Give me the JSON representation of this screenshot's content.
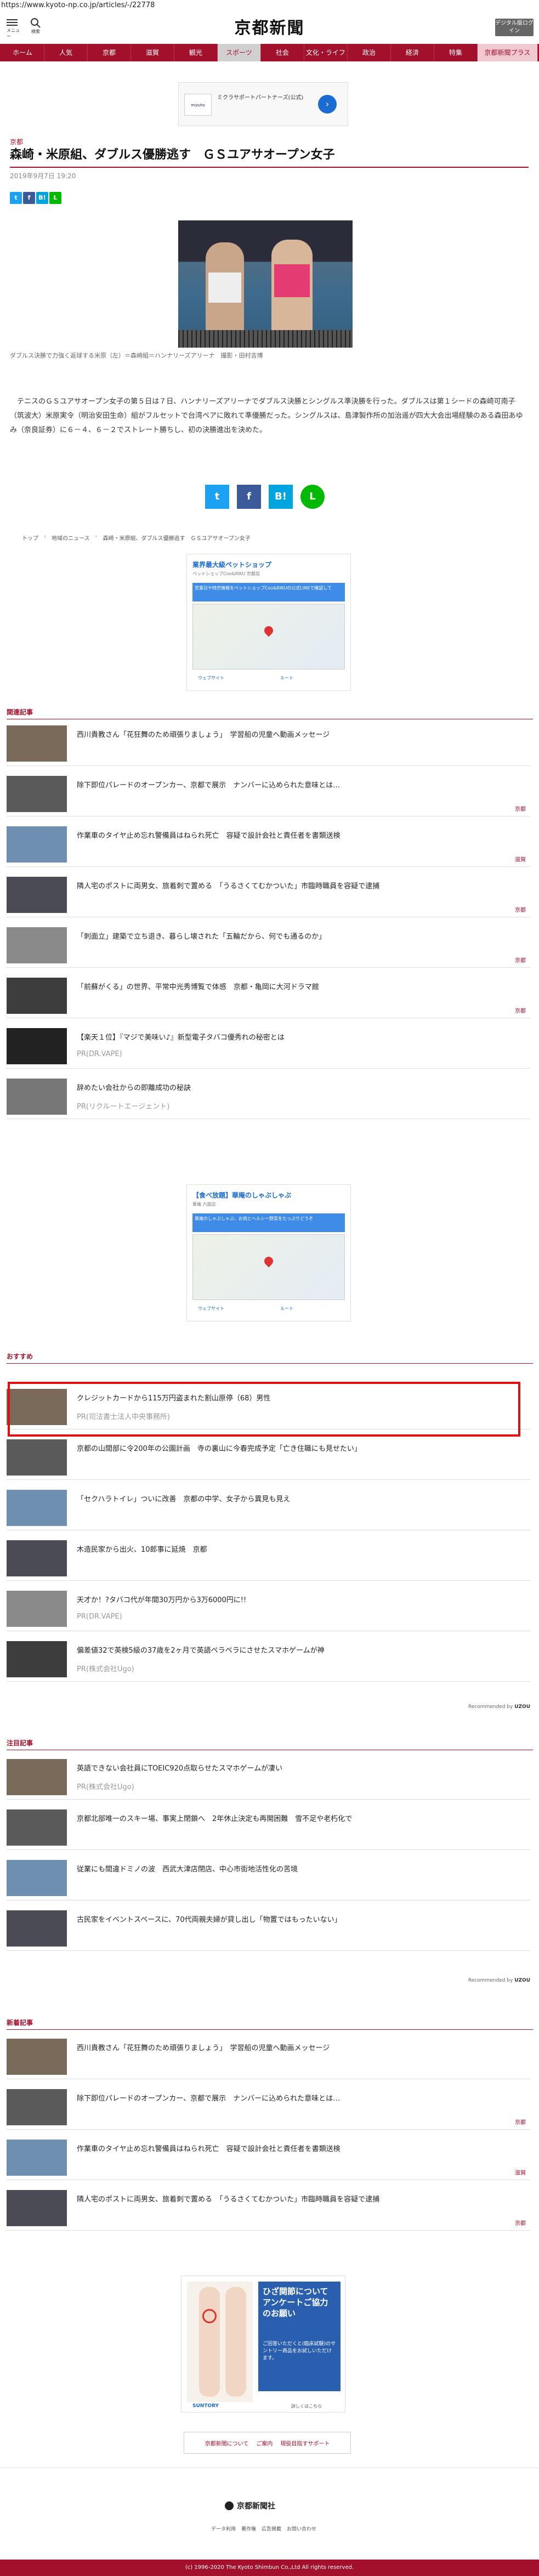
{
  "browser": {
    "url": "https://www.kyoto-np.co.jp/articles/-/22778"
  },
  "header": {
    "menu_label": "メニュー",
    "search_label": "検索",
    "logo": "京都新聞",
    "digital_btn": "デジタル版ログイン"
  },
  "gnav": [
    "ホーム",
    "人気",
    "京都",
    "滋賀",
    "観光",
    "スポーツ",
    "社会",
    "文化・ライフ",
    "政治",
    "経済",
    "特集",
    "京都新聞プラス"
  ],
  "ad_top": {
    "logo": "mizuho",
    "text": "ミクラサポートパートナーズ(公式)"
  },
  "article": {
    "category": "京都",
    "title": "森崎・米原組、ダブルス優勝逃す　ＧＳユアサオープン女子",
    "date": "2019年9月7日 19:20",
    "photo_caption": "ダブルス決勝で力強く返球する米原（左）＝森崎組＝ハンナリーズアリーナ　撮影・田村吉博",
    "body": "テニスのＧＳユアサオープン女子の第５日は７日、ハンナリーズアリーナでダブルス決勝とシングルス準決勝を行った。ダブルスは第１シードの森崎可南子（筑波大）米原実令（明治安田生命）組がフルセットで台湾ペアに敗れて準優勝だった。シングルスは、島津製作所の加治遥が四大大会出場経験のある森田あゆみ（奈良証券）に６－４、６－２でストレート勝ちし、初の決勝進出を決めた。"
  },
  "share": {
    "twitter": "t",
    "facebook": "f",
    "hatena": "B!",
    "line": "LINE"
  },
  "breadcrumb": [
    "トップ",
    "地域のニュース",
    "森崎・米原組、ダブルス優勝逃す　ＧＳユアサオープン女子"
  ],
  "map_ad1": {
    "title": "業界最大級ペットショップ",
    "subtitle": "ペットショップCoo&RIKU 京都店",
    "blue": "営業日や特売情報をペットショップCoo&RIKUの公式LINEで確認して",
    "route": "ルート",
    "website": "ウェブサイト"
  },
  "related": {
    "heading": "関連記事",
    "items": [
      {
        "title": "西川貴教さん「花狂舞のため頑張りましょう」　学習船の児童へ動画メッセージ",
        "meta": ""
      },
      {
        "title": "除下即位パレードのオープンカー、京都で展示　ナンバーに込められた意味とは…",
        "meta": "京都"
      },
      {
        "title": "作業車のタイヤ止め忘れ警備員はねられ死亡　容疑で設計会社と責任者を書類送検",
        "meta": "滋賀"
      },
      {
        "title": "隣人宅のポストに両男女、旅着刺で置める　「うるさくてむかついた」市臨時職員を容疑で逮捕",
        "meta": "京都"
      },
      {
        "title": "「刺面立」建築で立ち退き、暮らし壊された「五輪だから、何でも通るのか」",
        "meta": "京都"
      },
      {
        "title": "「前蘇がくる」の世界、平常中光秀博覧で体感　京都・亀岡に大河ドラマ館",
        "meta": "京都"
      },
      {
        "title": "【楽天１位】『マジで美味い♪』新型電子タバコ優秀れの秘密とは",
        "pr": "PR(DR.VAPE)"
      },
      {
        "title": "辞めたい会社からの即離成功の秘訣",
        "pr": "PR(リクルートエージェント)"
      }
    ]
  },
  "map_ad2": {
    "title": "【食べ放題】華庵のしゃぶしゃぶ",
    "subtitle": "華庵 六面店",
    "blue": "華庵のしゃぶしゃぶ、お肉とヘルシー野菜をたっぷりどうぞ",
    "route": "ルート",
    "website": "ウェブサイト"
  },
  "recommend": {
    "heading": "おすすめ",
    "items": [
      {
        "title": "クレジットカードから115万円盗まれた割山原停（68）男性",
        "pr": "PR(司法書士法人中央事務所)"
      },
      {
        "title": "京都の山間部に令200年の公園計画　寺の裏山に今春完成予定「亡き住職にも見せたい」",
        "meta": ""
      },
      {
        "title": "「セクハラトイレ」ついに改善　京都の中学、女子から異見も見え",
        "meta": ""
      },
      {
        "title": "木造民家から出火、10郎事に延焼　京都",
        "meta": ""
      },
      {
        "title": "天才か！?タバコ代が年間30万円から3万6000円に!!",
        "pr": "PR(DR.VAPE)"
      },
      {
        "title": "偏差値32で英検5級の37歳を2ヶ月で英語ペラペラにさせたスマホゲームが神",
        "pr": "PR(株式会社Ugo)"
      }
    ],
    "recommended_by": "Recommended by",
    "uzou": "UZOU"
  },
  "attention": {
    "heading": "注目記事",
    "items": [
      {
        "title": "英語できない会社員にTOEIC920点取らせたスマホゲームが凄い",
        "pr": "PR(株式会社Ugo)"
      },
      {
        "title": "京都北部唯一のスキー場、事実上閉鎖へ　2年休止決定も再開困難　雪不足や老朽化で",
        "meta": ""
      },
      {
        "title": "従業にも間違ドミノの波　西武大津店閉店、中心市街地活性化の苦境",
        "meta": ""
      },
      {
        "title": "古民家をイベントスペースに、70代両親夫婦が貸し出し「物置ではもったいない」",
        "meta": ""
      }
    ],
    "recommended_by": "Recommended by",
    "uzou": "UZOU"
  },
  "latest": {
    "heading": "新着記事",
    "items": [
      {
        "title": "西川貴教さん「花狂舞のため頑張りましょう」　学習船の児童へ動画メッセージ",
        "meta": ""
      },
      {
        "title": "除下即位パレードのオープンカー、京都で展示　ナンバーに込められた意味とは…",
        "meta": "京都"
      },
      {
        "title": "作業車のタイヤ止め忘れ警備員はねられ死亡　容疑で設計会社と責任者を書類送検",
        "meta": "滋賀"
      },
      {
        "title": "隣人宅のポストに両男女、旅着刺で置める　「うるさくてむかついた」市臨時職員を容疑で逮捕",
        "meta": "京都"
      }
    ]
  },
  "ad_bottom": {
    "title": "ひざ関節についてアンケートご協力のお願い",
    "body": "ご回答いただくと(臨床試験)のサントリー商品をお試しいただけます。",
    "brand": "SUNTORY",
    "more": "詳しくはこちら"
  },
  "footer": {
    "links": [
      "京都新聞について",
      "ご案内",
      "現役目指すサポート"
    ],
    "brand": "京都新聞社",
    "nav": [
      "データ利用",
      "著作権",
      "広告掲載",
      "お問い合わせ"
    ],
    "copyright": "(c) 1996-2020 The Kyoto Shimbun Co.,Ltd All rights reserved."
  }
}
